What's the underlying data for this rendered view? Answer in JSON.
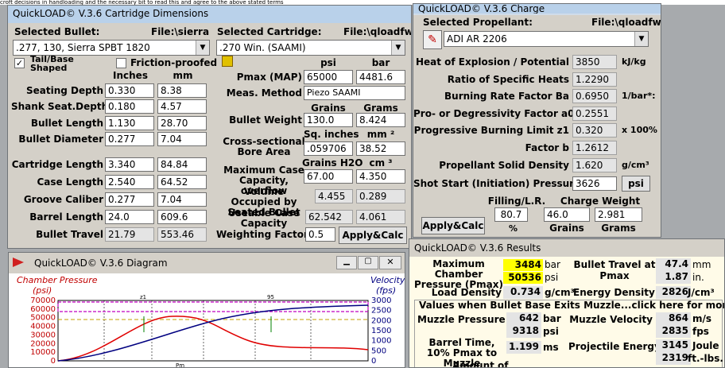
{
  "top_strip": "croft decisions in handloading and the necessary bit to read this and agree to the above stated terms",
  "dims": {
    "title": "QuickLOAD© V.3.6 Cartridge Dimensions",
    "selected_bullet_label": "Selected Bullet:",
    "bullet_file": "File:\\sierra",
    "bullet_value": ".277, 130, Sierra SPBT 1820",
    "selected_cartridge_label": "Selected Cartridge:",
    "cartridge_file": "File:\\qloadfw",
    "cartridge_value": ".270 Win. (SAAMI)",
    "tail_base_label": "Tail/Base Shaped",
    "friction_label": "Friction-proofed",
    "col_inches": "Inches",
    "col_mm": "mm",
    "rows": [
      {
        "label": "Seating Depth",
        "inches": "0.330",
        "mm": "8.38"
      },
      {
        "label": "Shank Seat.Depth",
        "inches": "0.180",
        "mm": "4.57"
      },
      {
        "label": "Bullet Length",
        "inches": "1.130",
        "mm": "28.70"
      },
      {
        "label": "Bullet Diameter",
        "inches": "0.277",
        "mm": "7.04"
      },
      {
        "label": "Cartridge Length",
        "inches": "3.340",
        "mm": "84.84"
      },
      {
        "label": "Case Length",
        "inches": "2.540",
        "mm": "64.52"
      },
      {
        "label": "Groove Caliber",
        "inches": "0.277",
        "mm": "7.04"
      },
      {
        "label": "Barrel Length",
        "inches": "24.0",
        "mm": "609.6"
      },
      {
        "label": "Bullet Travel",
        "inches": "21.79",
        "mm": "553.46"
      }
    ],
    "psi_hdr": "psi",
    "bar_hdr": "bar",
    "pmax_label": "Pmax (MAP)",
    "pmax_psi": "65000",
    "pmax_bar": "4481.6",
    "meas_label": "Meas. Method",
    "meas_value": "Piezo SAAMI",
    "grains_hdr": "Grains",
    "grams_hdr": "Grams",
    "bw_label": "Bullet Weight",
    "bw_grains": "130.0",
    "bw_grams": "8.424",
    "sq_in_hdr": "Sq. inches",
    "mm2_hdr": "mm ²",
    "bore_label": "Cross-sectional Bore Area",
    "bore_sqin": ".059706",
    "bore_mm2": "38.52",
    "h2o_hdr": "Grains H2O",
    "cm3_hdr": "cm ³",
    "maxcase_label": "Maximum Case Capacity, overflow",
    "maxcase_gr": "67.00",
    "maxcase_cm3": "4.350",
    "volocc_label": "Volume Occupied by Seated Bullet",
    "volocc_gr": "4.455",
    "volocc_cm3": "0.289",
    "usecase_label": "Useable Case Capacity",
    "usecase_gr": "62.542",
    "usecase_cm3": "4.061",
    "wf_label": "Weighting Factor",
    "wf_value": "0.5",
    "apply_label": "Apply&Calc"
  },
  "charge": {
    "title": "QuickLOAD© V.3.6 Charge",
    "sel_prop_label": "Selected Propellant:",
    "prop_file": "File:\\qloadfw",
    "prop_value": "ADI AR 2206",
    "rows": [
      {
        "label": "Heat of Explosion / Potential",
        "value": "3850",
        "unit": "kJ/kg"
      },
      {
        "label": "Ratio of Specific Heats",
        "value": "1.2290",
        "unit": ""
      },
      {
        "label": "Burning Rate Factor  Ba",
        "value": "0.6950",
        "unit": "1/bar*:"
      },
      {
        "label": "Pro- or Degressivity Factor  a0",
        "value": "0.2551",
        "unit": ""
      },
      {
        "label": "Progressive Burning Limit z1",
        "value": "0.320",
        "unit": "x 100%"
      },
      {
        "label": "Factor  b",
        "value": "1.2612",
        "unit": ""
      },
      {
        "label": "Propellant Solid Density",
        "value": "1.620",
        "unit": "g/cm³"
      },
      {
        "label": "Shot Start (Initiation) Pressure",
        "value": "3626",
        "unit": "psi"
      }
    ],
    "filling_label": "Filling/L.R.",
    "charge_weight_label": "Charge Weight",
    "filling_value": "80.7",
    "grains_value": "46.0",
    "grams_value": "2.981",
    "pct": "%",
    "grains_lbl": "Grains",
    "grams_lbl": "Grams",
    "apply_label": "Apply&Calc"
  },
  "diagram": {
    "title": "QuickLOAD© V.3.6 Diagram",
    "left_title": "Chamber Pressure",
    "left_unit": "(psi)",
    "right_title": "Velocity",
    "right_unit": "(fps)",
    "left_ticks": [
      "70000",
      "60000",
      "50000",
      "40000",
      "30000",
      "20000",
      "10000",
      "0"
    ],
    "right_ticks": [
      "3000",
      "2500",
      "2000",
      "1500",
      "1000",
      "500",
      "0"
    ],
    "z1_label": "z1",
    "mark95": "95",
    "pm_label": "Pm",
    "colors": {
      "pressure": "#e00000",
      "velocity": "#000080",
      "band": "#c000c0"
    }
  },
  "results": {
    "title": "QuickLOAD© V.3.6 Results",
    "max_chamber_label": "Maximum Chamber Pressure (Pmax)",
    "pmax_bar": "3484",
    "bar_unit": "bar",
    "pmax_psi": "50536",
    "psi_unit": "psi",
    "travel_label": "Bullet Travel at Pmax",
    "travel_mm": "47.4",
    "mm_unit": "mm",
    "travel_in": "1.87",
    "in_unit": "in.",
    "load_density_label": "Load Density",
    "load_density": "0.734",
    "gcm3_unit": "g/cm³",
    "energy_density_label": "Energy Density",
    "energy_density": "2826",
    "jcm3_unit": "J/cm³",
    "muzzle_header": "Values when Bullet Base Exits Muzzle...click here for more data",
    "muzzle_pressure_label": "Muzzle Pressure",
    "muzzle_pressure_bar": "642",
    "muzzle_pressure_psi": "9318",
    "muzzle_velocity_label": "Muzzle Velocity",
    "muzzle_velocity_ms": "864",
    "ms_unit": "m/s",
    "muzzle_velocity_fps": "2835",
    "fps_unit": "fps",
    "barrel_time_label": "Barrel Time, 10% Pmax to Muzzle",
    "barrel_time": "1.199",
    "ms2_unit": "ms",
    "energy_label": "Projectile Energy",
    "energy_joule": "3145",
    "joule_unit": "Joule",
    "energy_ftlbs": "2319",
    "ftlbs_unit": "ft.-lbs.",
    "amount_label": "Amount of"
  }
}
